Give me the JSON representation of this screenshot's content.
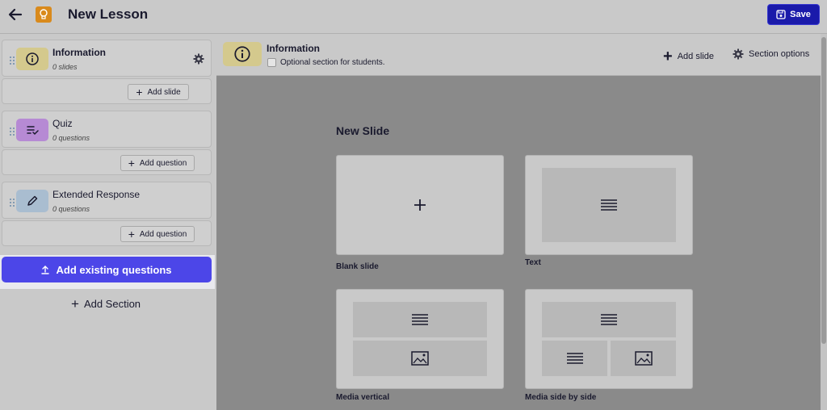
{
  "header": {
    "title": "New Lesson",
    "save_label": "Save"
  },
  "sidebar": {
    "sections": [
      {
        "title": "Information",
        "subtitle": "0 slides",
        "action_label": "Add slide",
        "icon": "info-icon",
        "color": "#d4c98d"
      },
      {
        "title": "Quiz",
        "subtitle": "0 questions",
        "action_label": "Add question",
        "icon": "checklist-icon",
        "color": "#b68ad4"
      },
      {
        "title": "Extended Response",
        "subtitle": "0 questions",
        "action_label": "Add question",
        "icon": "pencil-icon",
        "color": "#a9bdd0"
      }
    ],
    "add_existing_label": "Add existing questions",
    "add_section_label": "Add Section"
  },
  "section_bar": {
    "title": "Information",
    "checkbox_label": "Optional section for students.",
    "checkbox_checked": false,
    "add_slide_label": "Add slide",
    "options_label": "Section options"
  },
  "main": {
    "heading": "New Slide",
    "templates": [
      {
        "label": "Blank slide"
      },
      {
        "label": "Text"
      },
      {
        "label": "Media vertical"
      },
      {
        "label": "Media side by side"
      }
    ]
  },
  "colors": {
    "primary": "#4c46e8",
    "save": "#1a1aaa",
    "lesson_icon": "#d98a1c"
  }
}
